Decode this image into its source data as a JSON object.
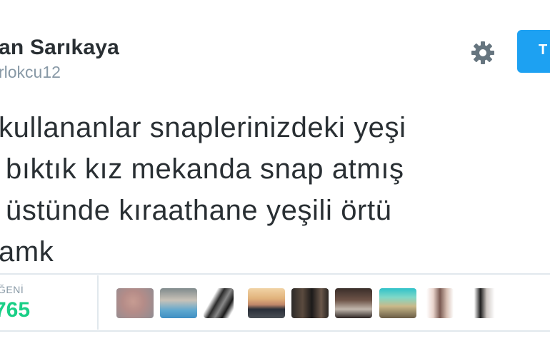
{
  "profile": {
    "display_name": "an Sarıkaya",
    "handle": "rlokcu12"
  },
  "header": {
    "settings_icon": "gear-icon",
    "follow_label": "T"
  },
  "tweet": {
    "lines": [
      "kullananlar snaplerinizdeki yeşi",
      "bıktık kız mekanda snap atmış",
      "üstünde kıraathane yeşili örtü",
      "amk"
    ]
  },
  "stats": {
    "likes_label": "ĞENİ",
    "likes_value": "765"
  },
  "likers": {
    "count": 10
  },
  "colors": {
    "accent": "#1da1f2",
    "likes_green": "#19cf86",
    "muted": "#8899a6",
    "divider": "#e1e8ed",
    "text": "#292f33"
  }
}
